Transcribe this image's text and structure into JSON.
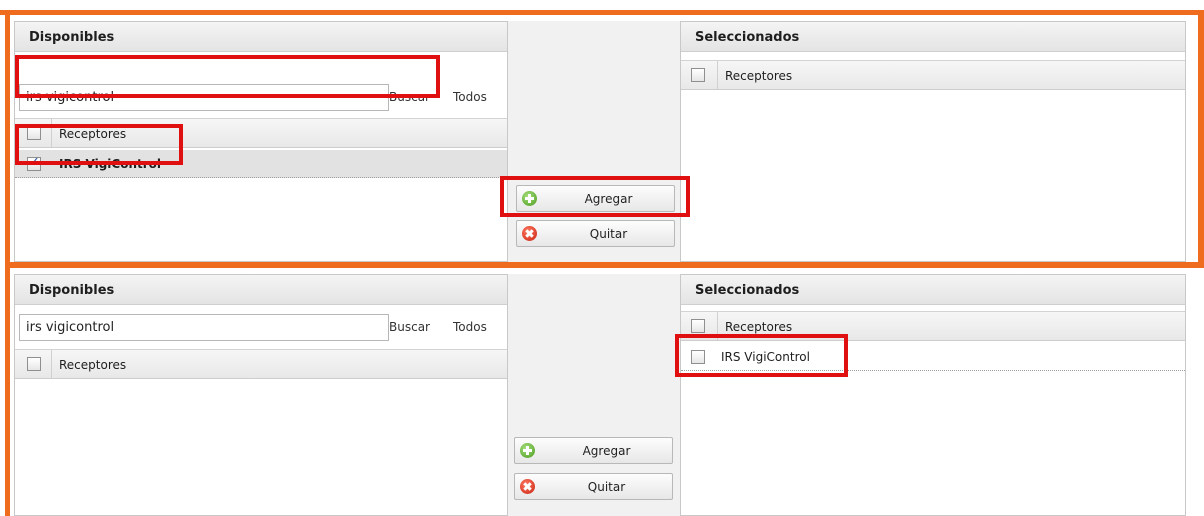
{
  "shot1": {
    "available": {
      "title": "Disponibles",
      "search_value": "irs vigicontrol",
      "search_button": "Buscar",
      "all_button": "Todos",
      "column_header": "Receptores",
      "rows": [
        {
          "label": "IRS VigiControl",
          "checked": true
        }
      ]
    },
    "actions": {
      "add_label": "Agregar",
      "remove_label": "Quitar"
    },
    "selected": {
      "title": "Seleccionados",
      "column_header": "Receptores",
      "rows": []
    }
  },
  "shot2": {
    "available": {
      "title": "Disponibles",
      "search_value": "irs vigicontrol",
      "search_button": "Buscar",
      "all_button": "Todos",
      "column_header": "Receptores",
      "rows": []
    },
    "actions": {
      "add_label": "Agregar",
      "remove_label": "Quitar"
    },
    "selected": {
      "title": "Seleccionados",
      "column_header": "Receptores",
      "rows": [
        {
          "label": "IRS VigiControl",
          "checked": false
        }
      ]
    }
  },
  "colors": {
    "frame": "#ef6c1e",
    "highlight": "#e01010",
    "add_icon": "#4a9a1f",
    "remove_icon": "#c9220f"
  },
  "icons": {
    "add": "add-circle-icon",
    "remove": "remove-circle-icon"
  }
}
